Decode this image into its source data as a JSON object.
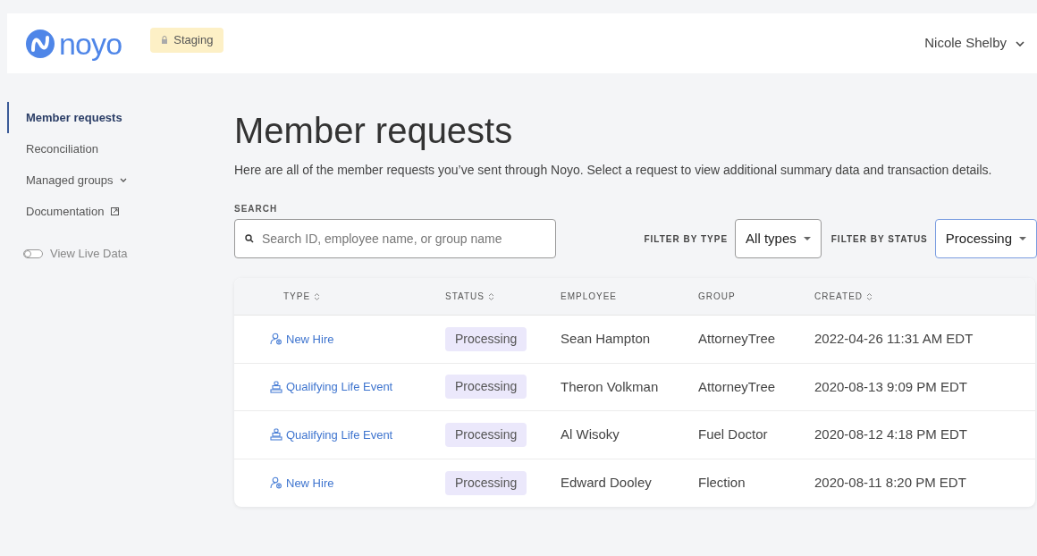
{
  "header": {
    "logo": "noyo",
    "environment": "Staging",
    "user": "Nicole Shelby"
  },
  "sidebar": {
    "items": [
      {
        "label": "Member requests",
        "selected": true,
        "kind": "link"
      },
      {
        "label": "Reconciliation",
        "selected": false,
        "kind": "link"
      },
      {
        "label": "Managed groups",
        "selected": false,
        "kind": "dropdown"
      },
      {
        "label": "Documentation",
        "selected": false,
        "kind": "external"
      }
    ],
    "toggle": {
      "label": "View Live Data",
      "on": false
    }
  },
  "page": {
    "title": "Member requests",
    "description": "Here are all of the member requests you’ve sent through Noyo. Select a request to view additional summary data and transaction details."
  },
  "search": {
    "label": "SEARCH",
    "placeholder": "Search ID, employee name, or group name"
  },
  "filters": [
    {
      "label": "FILTER BY TYPE",
      "value": "All types",
      "focused": false
    },
    {
      "label": "FILTER BY STATUS",
      "value": "Processing",
      "focused": true
    }
  ],
  "table": {
    "columns": [
      {
        "label": "TYPE",
        "sortable": true
      },
      {
        "label": "STATUS",
        "sortable": true
      },
      {
        "label": "EMPLOYEE",
        "sortable": false
      },
      {
        "label": "GROUP",
        "sortable": false
      },
      {
        "label": "CREATED",
        "sortable": true
      }
    ],
    "rows": [
      {
        "kind": "new_hire",
        "type": "New Hire",
        "status": "Processing",
        "employee": "Sean Hampton",
        "group": "AttorneyTree",
        "created": "2022-04-26 11:31 AM EDT"
      },
      {
        "kind": "life_event",
        "type": "Qualifying Life Event",
        "status": "Processing",
        "employee": "Theron Volkman",
        "group": "AttorneyTree",
        "created": "2020-08-13 9:09 PM EDT"
      },
      {
        "kind": "life_event",
        "type": "Qualifying Life Event",
        "status": "Processing",
        "employee": "Al Wisoky",
        "group": "Fuel Doctor",
        "created": "2020-08-12 4:18 PM EDT"
      },
      {
        "kind": "new_hire",
        "type": "New Hire",
        "status": "Processing",
        "employee": "Edward Dooley",
        "group": "Flection",
        "created": "2020-08-11 8:20 PM EDT"
      }
    ]
  }
}
